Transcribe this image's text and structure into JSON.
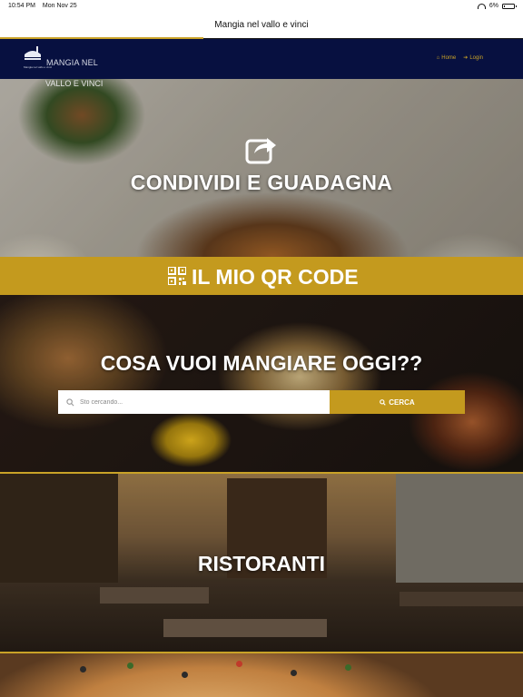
{
  "status_bar": {
    "time": "10:54 PM",
    "date": "Mon Nov 25",
    "battery": "6%",
    "battery_level": 0.06
  },
  "browser": {
    "title": "Mangia nel vallo e vinci"
  },
  "navbar": {
    "logo_text_line1": "MANGIA NEL",
    "logo_text_line2": "VALLO E VINCI",
    "logo_small_text": "Mangia nel vallo e vinci",
    "links": [
      {
        "label": "Home",
        "icon": "home-icon"
      },
      {
        "label": "Login",
        "icon": "login-icon"
      }
    ],
    "accent_color": "#c9a227",
    "background_color": "#071040"
  },
  "share_section": {
    "icon": "share-icon",
    "title": "CONDIVIDI E GUADAGNA"
  },
  "qr_section": {
    "icon": "qr-code-icon",
    "label": "IL MIO QR CODE",
    "color": "#c49a1e"
  },
  "search_section": {
    "title": "COSA VUOI MANGIARE OGGI??",
    "placeholder": "Sto cercando...",
    "button_label": "CERCA",
    "button_icon": "search-icon"
  },
  "restaurants_section": {
    "title": "RISTORANTI"
  }
}
